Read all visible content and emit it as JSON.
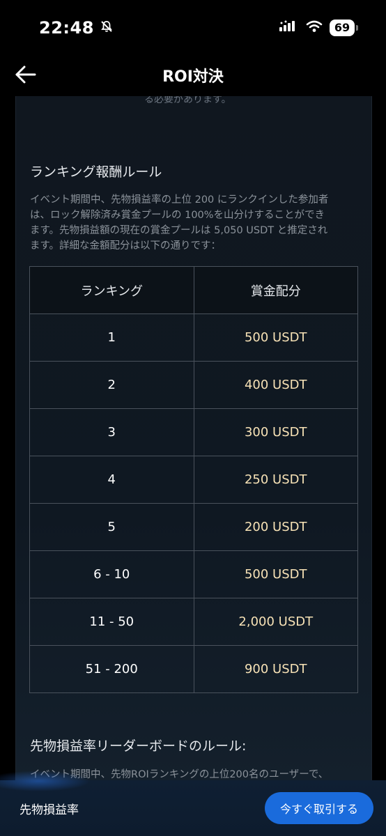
{
  "status_bar": {
    "time": "22:48",
    "battery": "69",
    "icons": [
      "bell-slash-icon",
      "cellular-signal-icon",
      "wifi-icon",
      "battery-icon"
    ]
  },
  "nav": {
    "title": "ROI対決",
    "back_icon": "arrow-left-icon"
  },
  "content": {
    "cut_off_text": "る必要があります。",
    "ranking_section": {
      "title": "ランキング報酬ルール",
      "lines": [
        "イベント期間中、先物損益率の上位 200 にランクインした参加者",
        "は、ロック解除済み賞金プールの 100%を山分けすることができ",
        "ます。先物損益額の現在の賞金プールは 5,050 USDT と推定され",
        "ます。詳細な金額配分は以下の通りです："
      ]
    },
    "table": {
      "headers": {
        "rank": "ランキング",
        "reward": "賞金配分"
      },
      "rows": [
        {
          "rank": "1",
          "reward": "500 USDT"
        },
        {
          "rank": "2",
          "reward": "400 USDT"
        },
        {
          "rank": "3",
          "reward": "300 USDT"
        },
        {
          "rank": "4",
          "reward": "250 USDT"
        },
        {
          "rank": "5",
          "reward": "200 USDT"
        },
        {
          "rank": "6 - 10",
          "reward": "500 USDT"
        },
        {
          "rank": "11 - 50",
          "reward": "2,000 USDT"
        },
        {
          "rank": "51 - 200",
          "reward": "900 USDT"
        }
      ]
    },
    "leaderboard_section": {
      "title": "先物損益率リーダーボードのルール:",
      "line": "イベント期間中、先物ROIランキングの上位200名のユーザーで、"
    }
  },
  "bottom_bar": {
    "label": "先物損益率",
    "trade_button": "今すぐ取引する"
  },
  "colors": {
    "accent_blue": "#1a6bdc",
    "reward_gold": "#f7e2b6",
    "background": "#000000",
    "card": "#10171f"
  }
}
